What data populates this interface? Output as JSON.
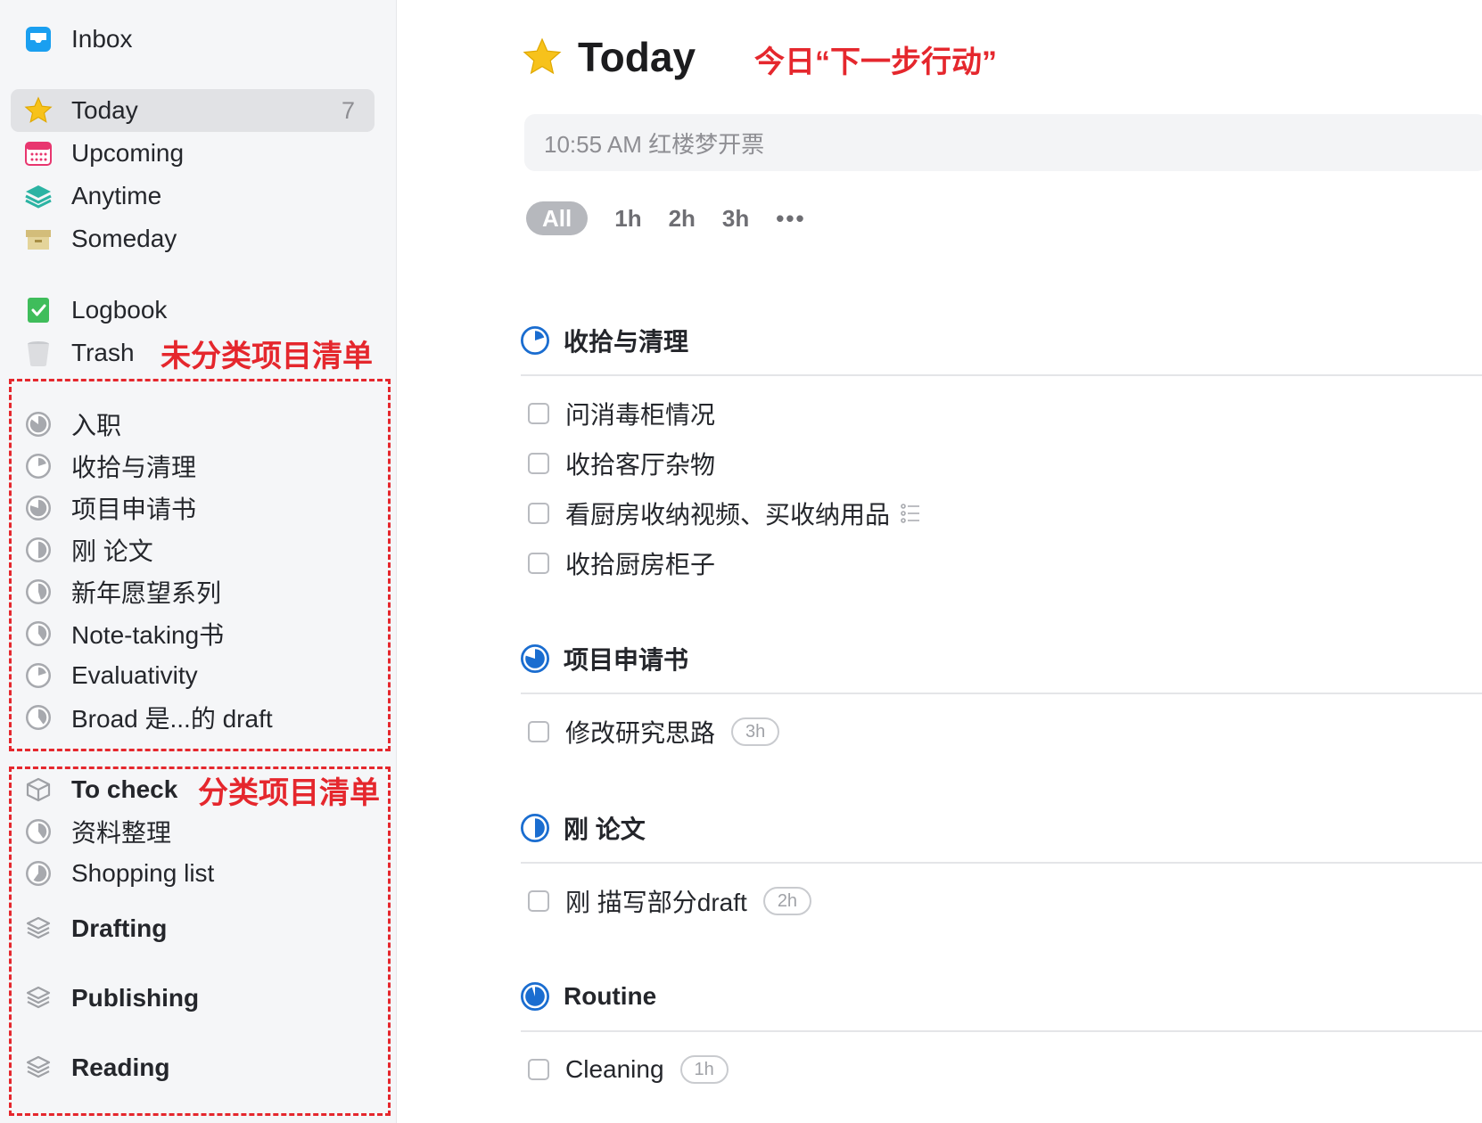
{
  "sidebar": {
    "inbox": {
      "label": "Inbox",
      "icon": "inbox-icon"
    },
    "today": {
      "label": "Today",
      "count": "7",
      "icon": "star-icon"
    },
    "upcoming": {
      "label": "Upcoming",
      "icon": "calendar-icon"
    },
    "anytime": {
      "label": "Anytime",
      "icon": "layers-icon"
    },
    "someday": {
      "label": "Someday",
      "icon": "archive-box-icon"
    },
    "logbook": {
      "label": "Logbook",
      "icon": "logbook-check-icon"
    },
    "trash": {
      "label": "Trash",
      "icon": "trash-icon"
    },
    "projects": [
      {
        "label": "入职",
        "progress": 0.85
      },
      {
        "label": "收拾与清理",
        "progress": 0.2
      },
      {
        "label": "项目申请书",
        "progress": 0.8
      },
      {
        "label": "刚 论文",
        "progress": 0.5
      },
      {
        "label": "新年愿望系列",
        "progress": 0.45
      },
      {
        "label": "Note-taking书",
        "progress": 0.4
      },
      {
        "label": "Evaluativity",
        "progress": 0.2
      },
      {
        "label": "Broad 是...的 draft",
        "progress": 0.4
      }
    ],
    "areas": [
      {
        "label": "To check",
        "projects": [
          {
            "label": "资料整理",
            "progress": 0.4
          },
          {
            "label": "Shopping list",
            "progress": 0.6
          }
        ]
      },
      {
        "label": "Drafting",
        "projects": []
      },
      {
        "label": "Publishing",
        "projects": []
      },
      {
        "label": "Reading",
        "projects": []
      }
    ]
  },
  "annotations": {
    "title_note": "今日“下一步行动”",
    "uncategorized": "未分类项目清单",
    "categorized": "分类项目清单"
  },
  "main": {
    "title": "Today",
    "quick_entry": "10:55 AM 红楼梦开票",
    "filters": [
      "All",
      "1h",
      "2h",
      "3h"
    ],
    "selected_filter": "All",
    "more": "•••",
    "sections": [
      {
        "title": "收拾与清理",
        "progress": 0.2,
        "todos": [
          {
            "text": "问消毒柜情况"
          },
          {
            "text": "收拾客厅杂物"
          },
          {
            "text": "看厨房收纳视频、买收纳用品",
            "has_notes": true
          },
          {
            "text": "收拾厨房柜子"
          }
        ]
      },
      {
        "title": "项目申请书",
        "progress": 0.8,
        "todos": [
          {
            "text": "修改研究思路",
            "tag": "3h"
          }
        ]
      },
      {
        "title": "刚 论文",
        "progress": 0.5,
        "todos": [
          {
            "text": "刚 描写部分draft",
            "tag": "2h"
          }
        ]
      },
      {
        "title": "Routine",
        "progress": 0.95,
        "todos": [
          {
            "text": "Cleaning",
            "tag": "1h"
          }
        ]
      }
    ]
  },
  "colors": {
    "accent_blue": "#1a6dd0",
    "annotation_red": "#e5272d",
    "star_yellow": "#f7c21b",
    "sidebar_bg": "#f5f6f8"
  }
}
